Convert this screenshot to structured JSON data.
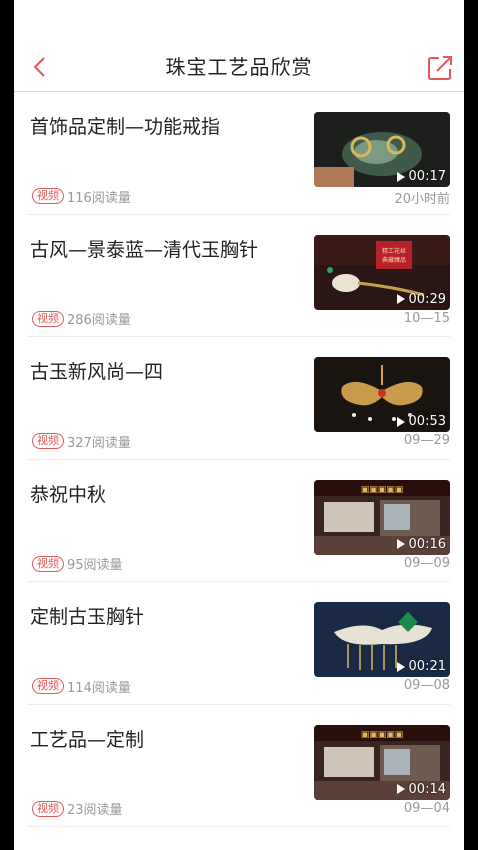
{
  "header": {
    "title": "珠宝工艺品欣赏",
    "accent": "#e05a5a"
  },
  "list": {
    "items": [
      {
        "title": "首饰品定制—功能戒指",
        "badge": "视频",
        "views": "116阅读量",
        "date": "20小时前",
        "duration": "00:17",
        "thumb_style": "ring"
      },
      {
        "title": "古风—景泰蓝—清代玉胸针",
        "badge": "视频",
        "views": "286阅读量",
        "date": "10—15",
        "duration": "00:29",
        "thumb_style": "brooch-red"
      },
      {
        "title": "古玉新风尚—四",
        "badge": "视频",
        "views": "327阅读量",
        "date": "09—29",
        "duration": "00:53",
        "thumb_style": "butterfly"
      },
      {
        "title": "恭祝中秋",
        "badge": "视频",
        "views": "95阅读量",
        "date": "09—09",
        "duration": "00:16",
        "thumb_style": "shop"
      },
      {
        "title": "定制古玉胸针",
        "badge": "视频",
        "views": "114阅读量",
        "date": "09—08",
        "duration": "00:21",
        "thumb_style": "jade-brooch"
      },
      {
        "title": "工艺品—定制",
        "badge": "视频",
        "views": "23阅读量",
        "date": "09—04",
        "duration": "00:14",
        "thumb_style": "shop"
      }
    ]
  }
}
